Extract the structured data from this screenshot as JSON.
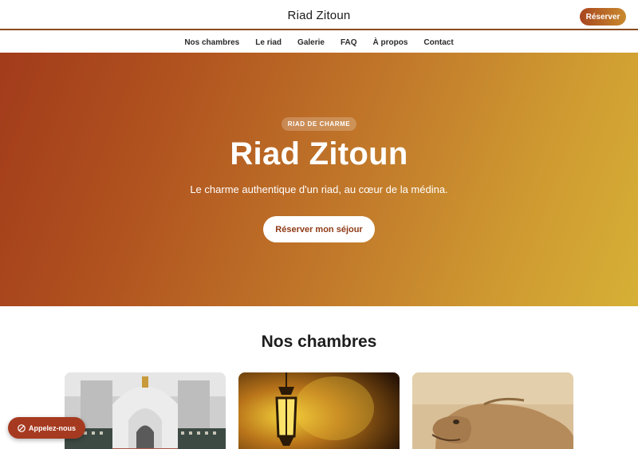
{
  "header": {
    "brand": "Riad Zitoun",
    "reserve_label": "Réserver"
  },
  "nav": {
    "items": [
      {
        "label": "Nos chambres"
      },
      {
        "label": "Le riad"
      },
      {
        "label": "Galerie"
      },
      {
        "label": "FAQ"
      },
      {
        "label": "À propos"
      },
      {
        "label": "Contact"
      }
    ]
  },
  "hero": {
    "badge": "RIAD DE CHARME",
    "title": "Riad Zitoun",
    "subtitle": "Le charme authentique d'un riad, au cœur de la médina.",
    "cta_label": "Réserver mon séjour"
  },
  "rooms": {
    "title": "Nos chambres",
    "cards": [
      {
        "image": "moroccan-courtyard-photo"
      },
      {
        "image": "lantern-photo"
      },
      {
        "image": "camel-photo"
      }
    ]
  },
  "call_button": {
    "label": "Appelez-nous",
    "icon": "phone-icon"
  },
  "colors": {
    "accent_dark": "#a63a20",
    "accent_gold": "#d6b036"
  }
}
